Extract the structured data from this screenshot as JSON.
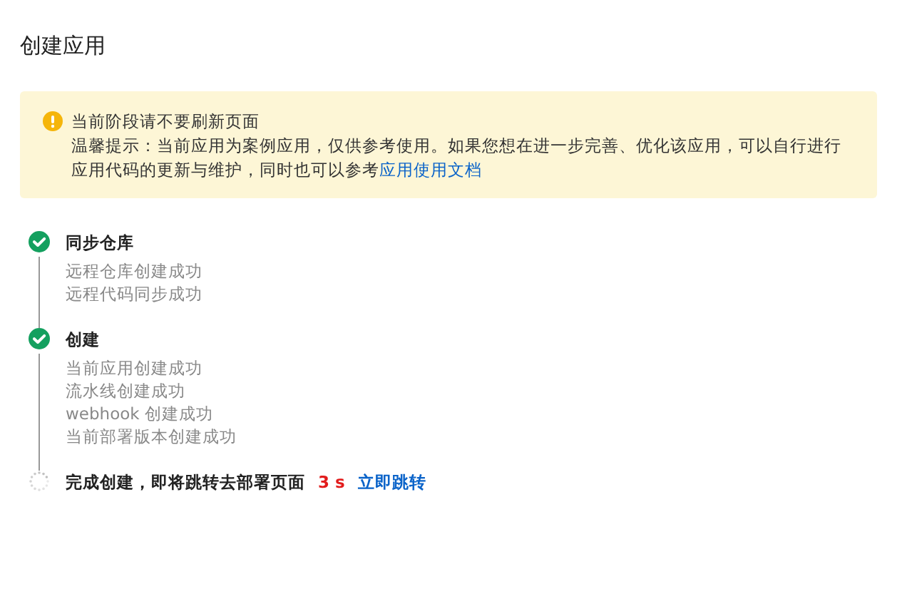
{
  "title": "创建应用",
  "alert": {
    "heading": "当前阶段请不要刷新页面",
    "text": "温馨提示：当前应用为案例应用，仅供参考使用。如果您想在进一步完善、优化该应用，可以自行进行应用代码的更新与维护，同时也可以参考",
    "link": "应用使用文档"
  },
  "steps": [
    {
      "kind": "done",
      "title": "同步仓库",
      "logs": [
        "远程仓库创建成功",
        "远程代码同步成功"
      ]
    },
    {
      "kind": "done",
      "title": "创建",
      "logs": [
        "当前应用创建成功",
        "流水线创建成功",
        "webhook 创建成功",
        "当前部署版本创建成功"
      ]
    },
    {
      "kind": "loading",
      "title": "完成创建，即将跳转去部署页面",
      "countdown": "3 s",
      "link": "立即跳转"
    }
  ]
}
